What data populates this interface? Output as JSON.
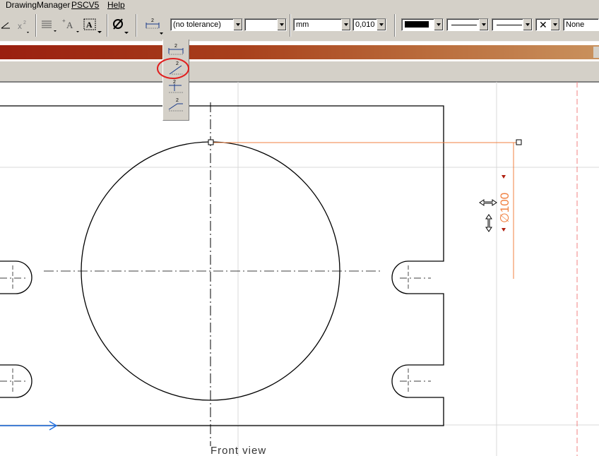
{
  "menu": {
    "items": [
      {
        "label": "DrawingManager"
      },
      {
        "label": "PSCV5",
        "mnemonic": "P"
      },
      {
        "label": "Help",
        "mnemonic": "H"
      }
    ]
  },
  "toolbar": {
    "tolerance_combo": {
      "value": "(no tolerance)"
    },
    "blank_combo": {
      "value": ""
    },
    "unit_combo": {
      "value": "mm"
    },
    "precision_combo": {
      "value": "0,010"
    },
    "color_combo": {
      "value": "#000000"
    },
    "line_end_combo": {
      "value": "None"
    },
    "icons": [
      "angle-icon",
      "superscript-icon",
      "text-align-icon",
      "text-insert-icon",
      "text-frame-icon",
      "diameter-icon",
      "dimension-type-icon"
    ]
  },
  "flyout": {
    "items": [
      "dimension-horizontal-icon",
      "dimension-slanted-icon",
      "dimension-cumulative-icon",
      "dimension-stacked-icon"
    ],
    "highlighted_index": 1
  },
  "drawing": {
    "view_label": "Front view",
    "dimension_text": "∅100",
    "colors": {
      "geometry": "#000000",
      "dimension": "#f08040",
      "axis_arrow": "#1e6ee0",
      "highlight_circle": "#e02020",
      "frame_line": "#f08080"
    }
  }
}
